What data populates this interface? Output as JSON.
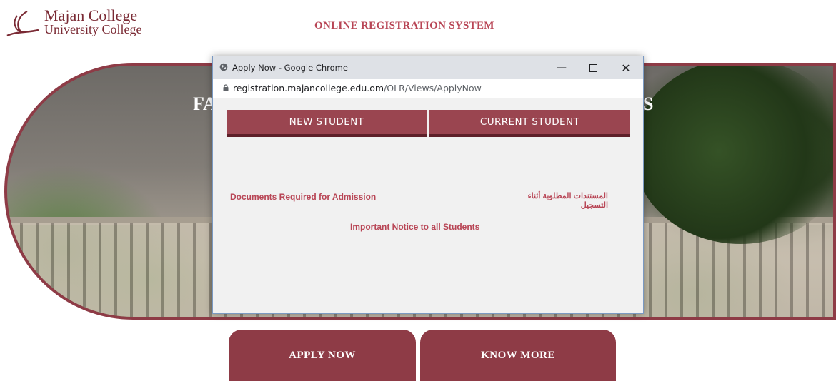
{
  "header": {
    "logo_line1": "Majan College",
    "logo_line2": "University College",
    "site_title": "ONLINE REGISTRATION SYSTEM"
  },
  "hero": {
    "text_left": "FA",
    "text_right": "S"
  },
  "cta": {
    "apply_label": "APPLY NOW",
    "know_label": "KNOW MORE"
  },
  "popup": {
    "window_title": "Apply Now - Google Chrome",
    "url_host": "registration.majancollege.edu.om",
    "url_path": "/OLR/Views/ApplyNow",
    "tabs": [
      {
        "label": "NEW STUDENT"
      },
      {
        "label": "CURRENT STUDENT"
      }
    ],
    "links": {
      "documents_en": "Documents Required for Admission",
      "documents_ar": "المستندات المطلوبة أثناء التسجيل",
      "notice": "Important Notice to all Students"
    }
  },
  "colors": {
    "brand_maroon": "#8e3b46",
    "link_red": "#b84555",
    "popup_bg": "#f1f1f1"
  },
  "icons": [
    "college-logo-icon",
    "globe-icon",
    "minimize-icon",
    "maximize-icon",
    "close-icon",
    "lock-icon"
  ]
}
